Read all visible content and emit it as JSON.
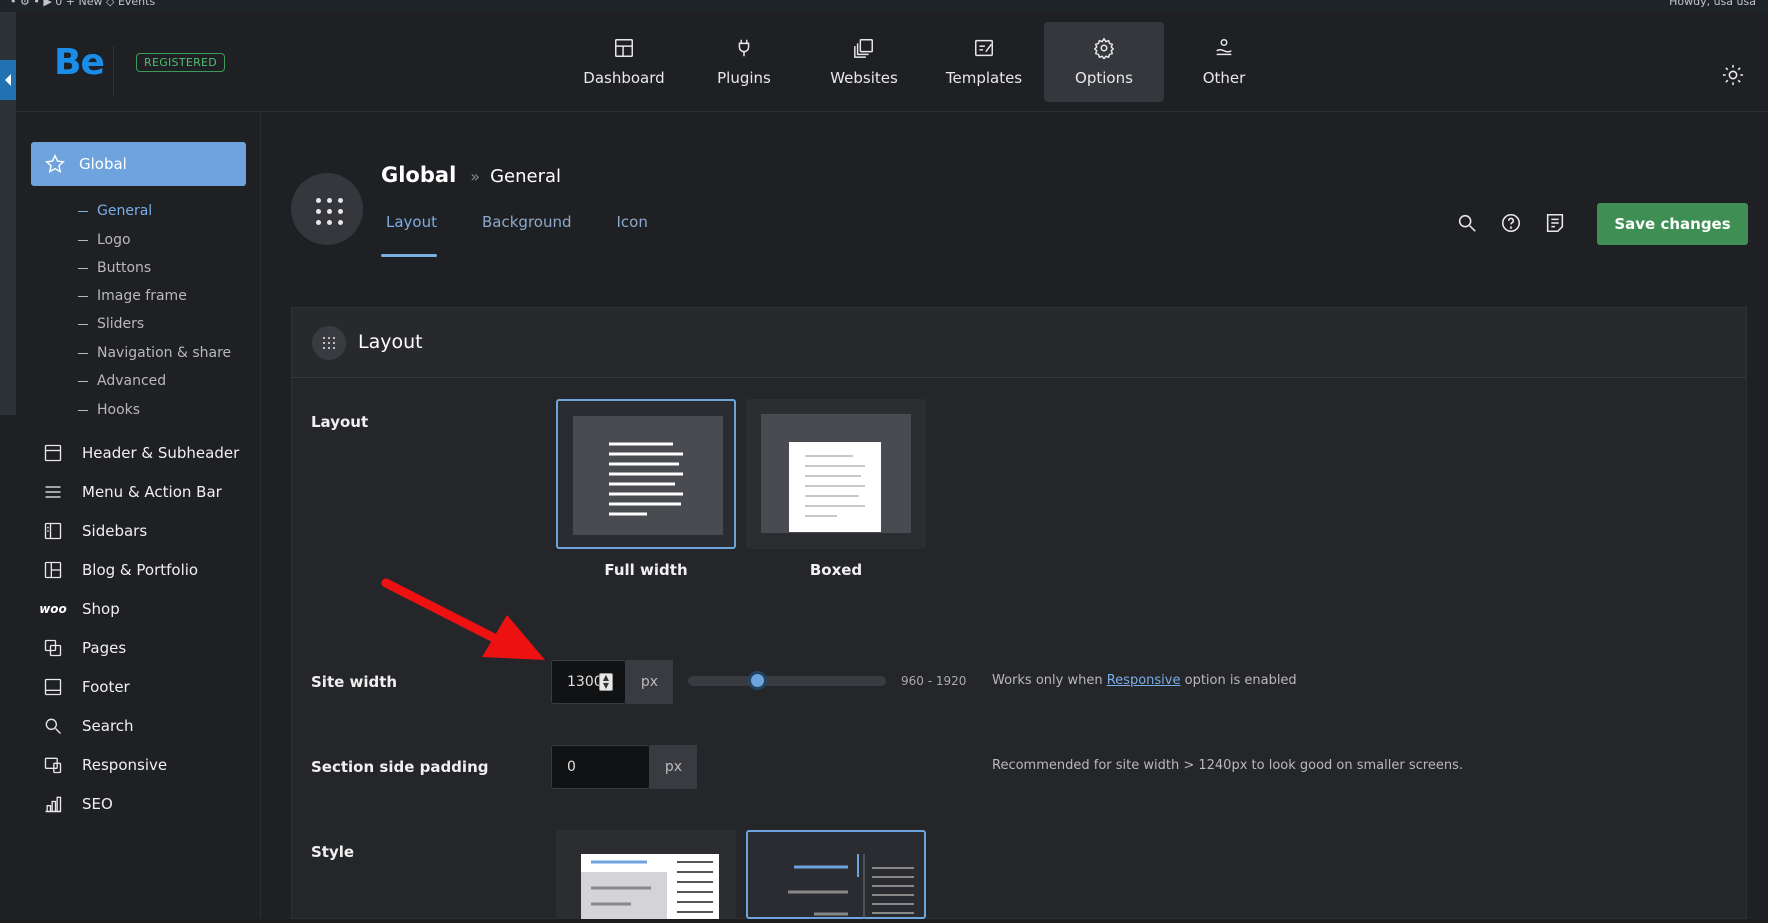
{
  "wpbar": {
    "left": "• ⚙ • ▶ 0  + New  ◇ Events",
    "right": "Howdy, usa usa"
  },
  "brand": {
    "logo": "Be",
    "badge": "REGISTERED"
  },
  "nav": [
    {
      "label": "Dashboard",
      "icon": "dashboard-icon"
    },
    {
      "label": "Plugins",
      "icon": "plug-icon"
    },
    {
      "label": "Websites",
      "icon": "websites-icon"
    },
    {
      "label": "Templates",
      "icon": "templates-icon"
    },
    {
      "label": "Options",
      "icon": "gear-icon",
      "active": true
    },
    {
      "label": "Other",
      "icon": "other-icon"
    }
  ],
  "sidebar": {
    "global": "Global",
    "sub": [
      "General",
      "Logo",
      "Buttons",
      "Image frame",
      "Sliders",
      "Navigation & share",
      "Advanced",
      "Hooks"
    ],
    "items": [
      "Header & Subheader",
      "Menu & Action Bar",
      "Sidebars",
      "Blog & Portfolio",
      "Shop",
      "Pages",
      "Footer",
      "Search",
      "Responsive",
      "SEO"
    ],
    "woo": "woo"
  },
  "header": {
    "title": "Global",
    "separator": "»",
    "current": "General",
    "tabs": [
      "Layout",
      "Background",
      "Icon"
    ],
    "save": "Save changes"
  },
  "panel": {
    "title": "Layout",
    "layout_label": "Layout",
    "layout_options": [
      "Full width",
      "Boxed"
    ],
    "site_width_label": "Site width",
    "site_width_value": "1300",
    "site_width_unit": "px",
    "site_width_range": "960 - 1920",
    "site_width_note_pre": "Works only when",
    "site_width_note_link": "Responsive",
    "site_width_note_post": "option is enabled",
    "padding_label": "Section side padding",
    "padding_value": "0",
    "padding_unit": "px",
    "padding_note": "Recommended for site width > 1240px to look good on smaller screens.",
    "style_label": "Style"
  },
  "colors": {
    "accent": "#6ea3de",
    "save": "#3f8f54",
    "brand": "#1a8de9"
  }
}
